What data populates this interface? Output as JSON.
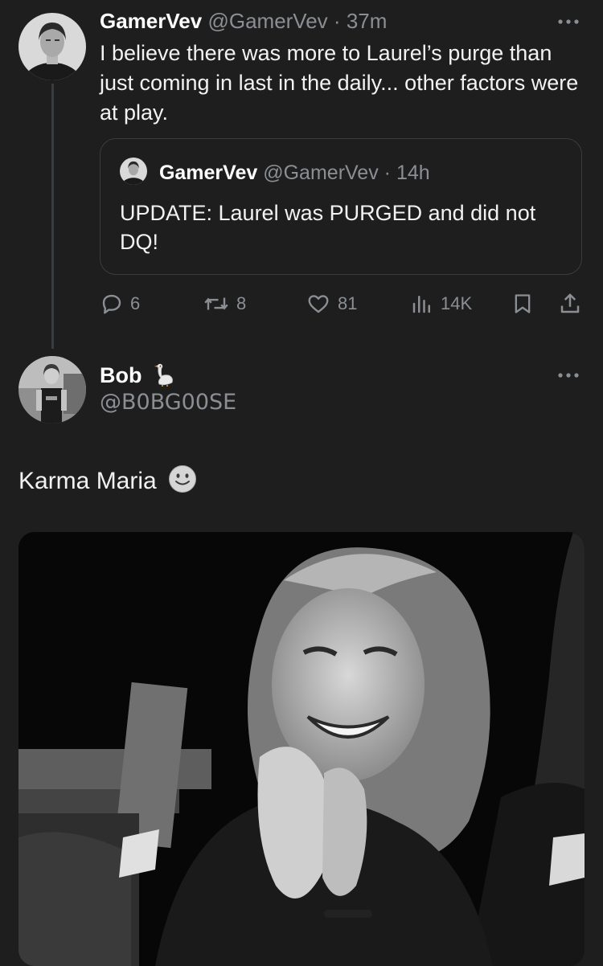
{
  "tweet1": {
    "name": "GamerVev",
    "handle": "@GamerVev",
    "separator": "·",
    "time": "37m",
    "text": "I believe there was more to Laurel’s purge than just coming in last in the daily... other factors were at play.",
    "quote": {
      "name": "GamerVev",
      "handle": "@GamerVev",
      "separator": "·",
      "time": "14h",
      "text": "UPDATE: Laurel was PURGED and did not DQ!"
    },
    "actions": {
      "replies": "6",
      "reposts": "8",
      "likes": "81",
      "views": "14K"
    }
  },
  "tweet2": {
    "name": "Bob",
    "name_emoji": "goose",
    "handle": "@B0BG00SE",
    "text": "Karma Maria",
    "text_emoji": "slightly-smiling-face",
    "media": "photo-laughing-woman"
  },
  "colors": {
    "background": "#1e1e1e",
    "text": "#e7e9ea",
    "muted": "#8b8f94",
    "border": "#3a3d40"
  },
  "icons": [
    "more-icon",
    "reply-icon",
    "repost-icon",
    "like-icon",
    "views-icon",
    "bookmark-icon",
    "share-icon"
  ]
}
